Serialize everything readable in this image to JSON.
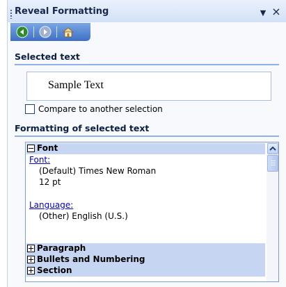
{
  "pane": {
    "title": "Reveal Formatting"
  },
  "nav": {
    "back_icon": "back-arrow-icon",
    "forward_icon": "forward-arrow-icon",
    "home_icon": "home-icon"
  },
  "selected": {
    "heading": "Selected text",
    "sample": "Sample Text",
    "compare_label": "Compare to another selection"
  },
  "formatting": {
    "heading": "Formatting of selected text",
    "font_group": "Font",
    "font_link": "Font:",
    "font_name": "(Default) Times New Roman",
    "font_size": "12 pt",
    "language_link": "Language:",
    "language_value": "(Other) English (U.S.)",
    "paragraph_group": "Paragraph",
    "bullets_group": "Bullets and Numbering",
    "section_group": "Section"
  },
  "colors": {
    "accent": "#3f6fc4",
    "group_bg": "#c6d6f2",
    "link": "#0000cc"
  }
}
